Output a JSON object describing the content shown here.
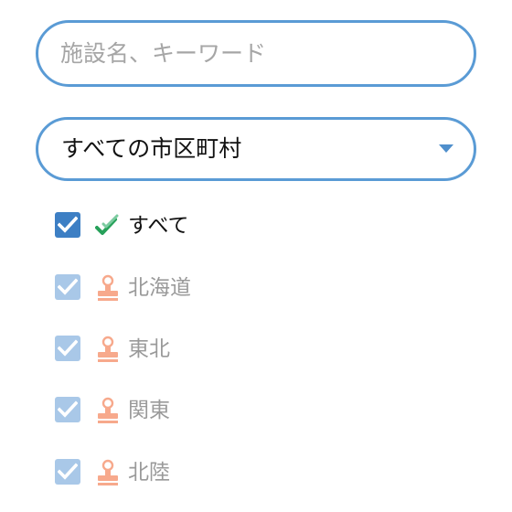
{
  "search": {
    "placeholder": "施設名、キーワード",
    "value": ""
  },
  "area_select": {
    "selected": "すべての市区町村"
  },
  "regions": [
    {
      "label": "すべて",
      "checked": true,
      "icon": "double-check-icon"
    },
    {
      "label": "北海道",
      "checked": true,
      "icon": "stamp-icon"
    },
    {
      "label": "東北",
      "checked": true,
      "icon": "stamp-icon"
    },
    {
      "label": "関東",
      "checked": true,
      "icon": "stamp-icon"
    },
    {
      "label": "北陸",
      "checked": true,
      "icon": "stamp-icon"
    }
  ],
  "colors": {
    "accent": "#5a9bd5",
    "checkbox_active": "#3d7fc4",
    "checkbox_dim": "#a9c8e8",
    "check_green": "#27a15a",
    "stamp": "#f7a98c"
  }
}
